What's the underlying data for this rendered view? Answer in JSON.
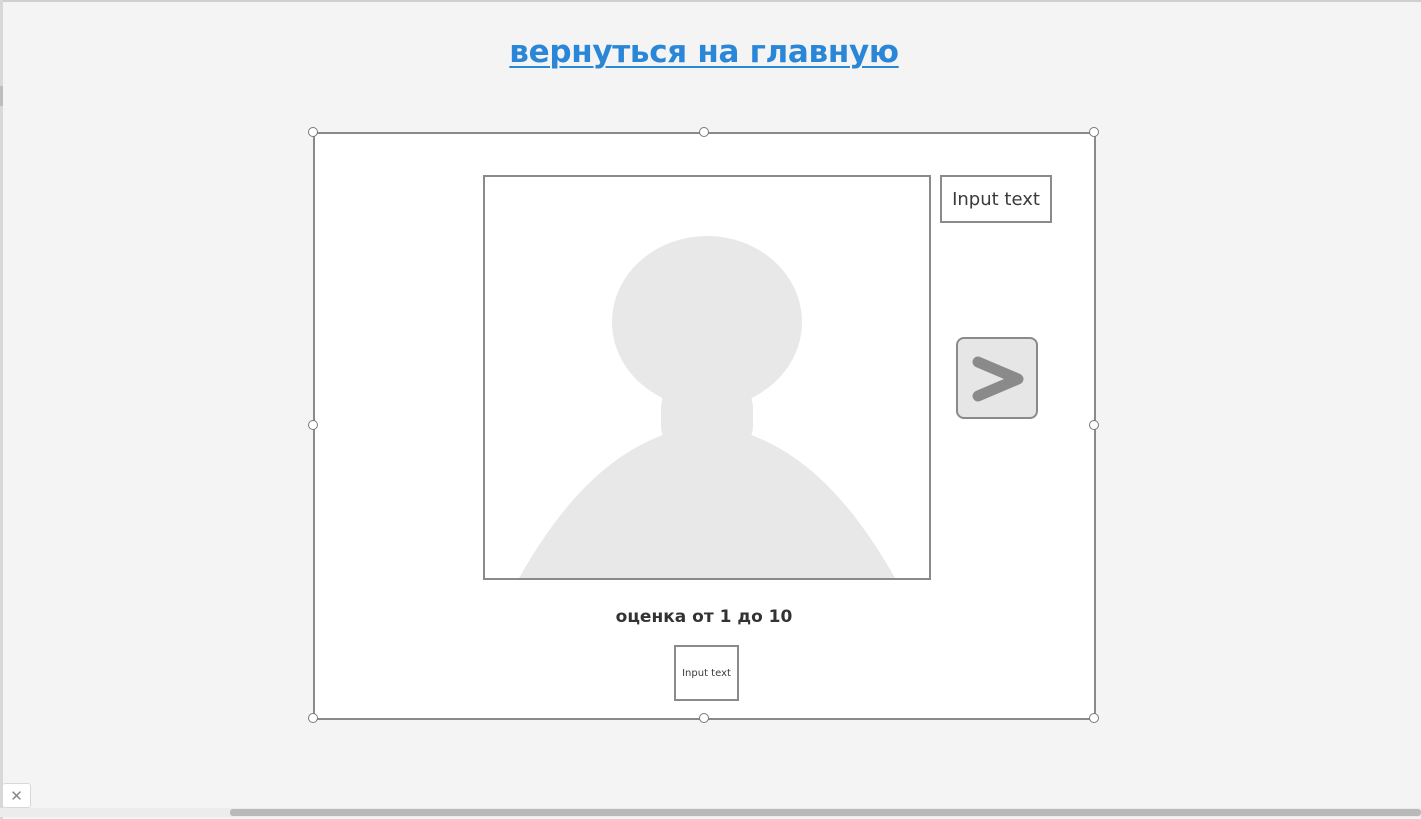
{
  "header": {
    "back_link": "вернуться на главную",
    "link_color": "#2a86d6"
  },
  "card": {
    "photo_icon": "person-placeholder-icon",
    "top_input": "Input text",
    "next_button_icon": "chevron-right-icon",
    "rating_label": "оценка от 1 до 10",
    "rating_input": "Input text"
  },
  "footer": {
    "close_icon": "close-icon",
    "close_glyph": "✕"
  }
}
